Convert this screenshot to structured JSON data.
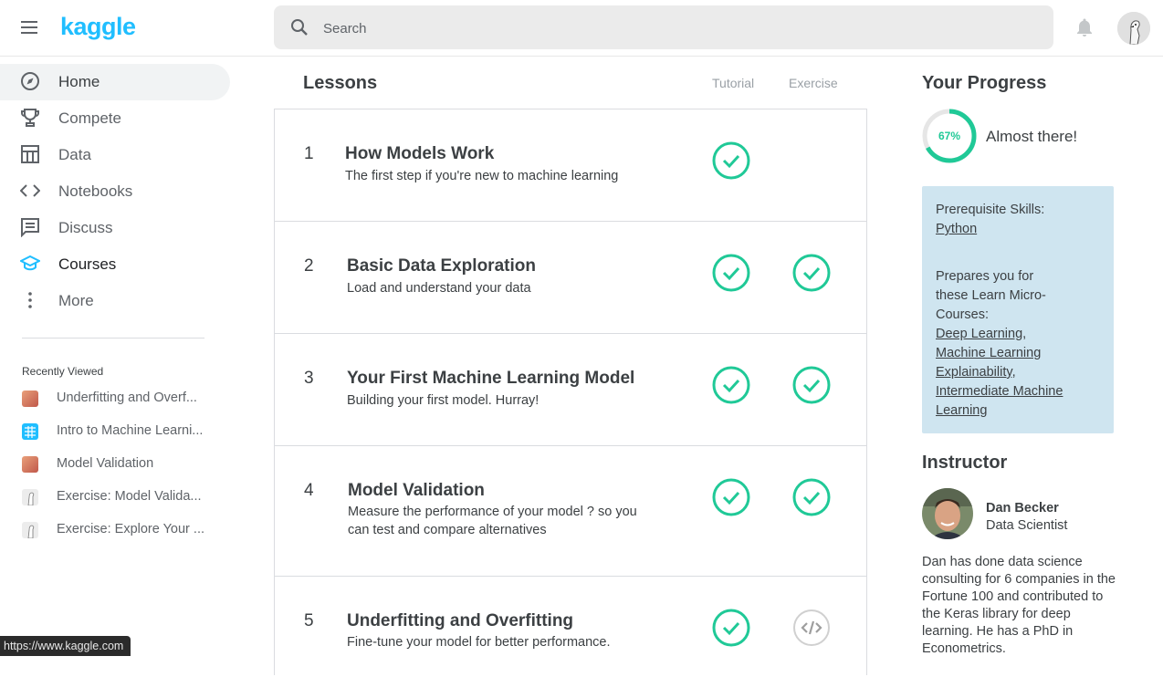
{
  "header": {
    "logo": "kaggle",
    "search_placeholder": "Search"
  },
  "sidebar": {
    "items": [
      {
        "label": "Home"
      },
      {
        "label": "Compete"
      },
      {
        "label": "Data"
      },
      {
        "label": "Notebooks"
      },
      {
        "label": "Discuss"
      },
      {
        "label": "Courses"
      },
      {
        "label": "More"
      }
    ],
    "recent_title": "Recently Viewed",
    "recent": [
      {
        "label": "Underfitting and Overf..."
      },
      {
        "label": "Intro to Machine Learni..."
      },
      {
        "label": "Model Validation"
      },
      {
        "label": "Exercise: Model Valida..."
      },
      {
        "label": "Exercise: Explore Your ..."
      }
    ]
  },
  "status_url": "https://www.kaggle.com",
  "lessons": {
    "heading": "Lessons",
    "col_tutorial": "Tutorial",
    "col_exercise": "Exercise",
    "items": [
      {
        "num": "1",
        "title": "How Models Work",
        "desc": "The first step if you're new to machine learning"
      },
      {
        "num": "2",
        "title": "Basic Data Exploration",
        "desc": "Load and understand your data"
      },
      {
        "num": "3",
        "title": "Your First Machine Learning Model",
        "desc": "Building your first model. Hurray!"
      },
      {
        "num": "4",
        "title": "Model Validation",
        "desc": "Measure the performance of your model ? so you can test and compare alternatives"
      },
      {
        "num": "5",
        "title": "Underfitting and Overfitting",
        "desc": "Fine-tune your model for better performance."
      }
    ]
  },
  "progress": {
    "heading": "Your Progress",
    "percent_label": "67%",
    "percent": 67,
    "message": "Almost there!"
  },
  "prereq": {
    "skills_label": "Prerequisite Skills:",
    "skill": "Python",
    "prepares_line1": "Prepares you for",
    "prepares_line2": "these Learn Micro-",
    "prepares_line3": "Courses:",
    "course1": "Deep Learning",
    "course2a": "Machine Learning",
    "course2b": "Explainability",
    "course3a": "Intermediate Machine",
    "course3b": "Learning"
  },
  "instructor": {
    "heading": "Instructor",
    "name": "Dan Becker",
    "role": "Data Scientist",
    "bio": "Dan has done data science consulting for 6 companies in the Fortune 100 and contributed to the Keras library for deep learning. He has a PhD in Econometrics."
  },
  "colors": {
    "brand": "#20beff",
    "check": "#20c997",
    "prereq_bg": "#cfe5f0"
  }
}
